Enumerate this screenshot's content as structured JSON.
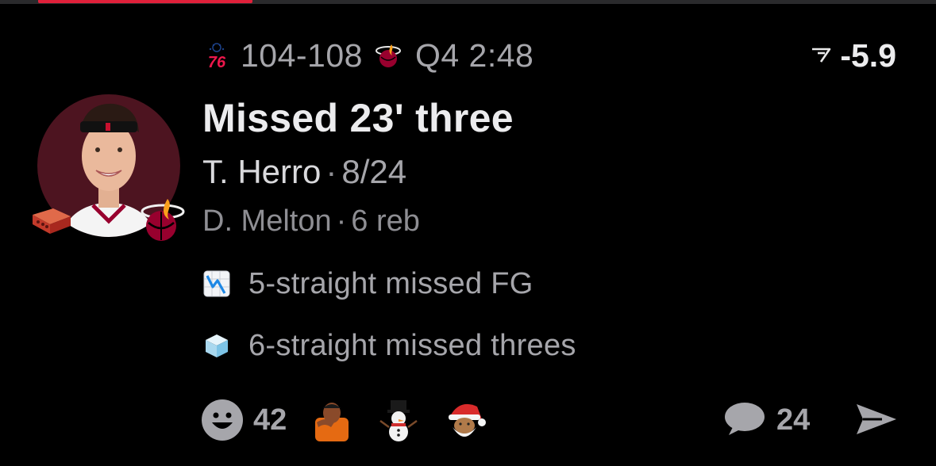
{
  "score_row": {
    "home_logo": "76ers-logo",
    "score": "104-108",
    "away_logo": "heat-logo",
    "clock": "Q4 2:48"
  },
  "spread": {
    "icon": "odds-arrow-icon",
    "value": "-5.9"
  },
  "avatar": {
    "player_photo": "player-photo",
    "badge_left": "brick-emoji",
    "badge_right": "heat-logo"
  },
  "play": {
    "headline": "Missed 23' three",
    "player_name": "T. Herro",
    "player_stat": "8/24",
    "separator": "·",
    "secondary_name": "D. Melton",
    "secondary_stat": "6 reb"
  },
  "facts": [
    {
      "icon": "chart-decreasing-emoji",
      "text": "5-straight missed FG"
    },
    {
      "icon": "ice-cube-emoji",
      "text": "6-straight missed threes"
    }
  ],
  "footer": {
    "reaction_icon": "smiley-icon",
    "reaction_count": "42",
    "reaction_emojis": [
      "drake-emoji",
      "snowman-emoji",
      "santa-emoji"
    ],
    "comment_icon": "comment-icon",
    "comment_count": "24",
    "share_icon": "send-icon"
  },
  "colors": {
    "background": "#000000",
    "accent": "#e0203a",
    "muted": "#a6a6ab",
    "heat_red": "#98002e"
  }
}
